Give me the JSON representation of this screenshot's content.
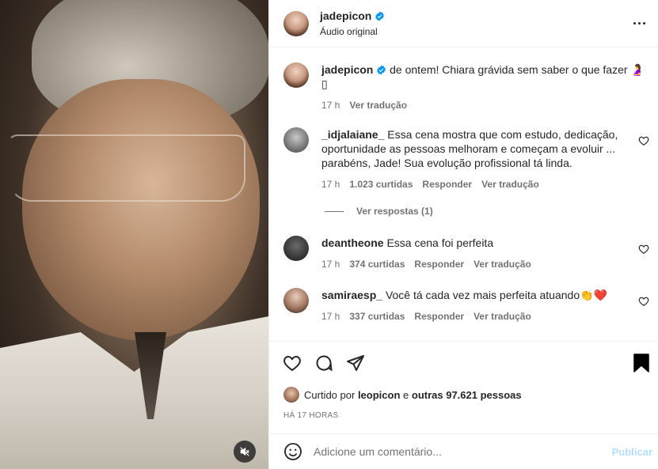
{
  "header": {
    "username": "jadepicon",
    "subtitle": "Áudio original"
  },
  "caption": {
    "username": "jadepicon",
    "text": "de ontem! Chiara grávida sem saber o que fazer 🤰",
    "text_line2": "▯",
    "time": "17 h",
    "see_translation": "Ver tradução"
  },
  "comments": [
    {
      "username": "_idjalaiane_",
      "text": "Essa cena mostra que com estudo, dedicação, oportunidade as pessoas melhoram e começam a evoluir ... parabéns, Jade! Sua evolução profissional tá linda.",
      "time": "17 h",
      "likes": "1.023 curtidas",
      "reply": "Responder",
      "translate": "Ver tradução"
    },
    {
      "username": "deantheone",
      "text": "Essa cena foi perfeita",
      "time": "17 h",
      "likes": "374 curtidas",
      "reply": "Responder",
      "translate": "Ver tradução"
    },
    {
      "username": "samiraesp_",
      "text": "Você tá cada vez mais perfeita atuando👏❤️",
      "time": "17 h",
      "likes": "337 curtidas",
      "reply": "Responder",
      "translate": "Ver tradução"
    }
  ],
  "view_replies": "Ver respostas (1)",
  "likes": {
    "prefix": "Curtido por",
    "user": "leopicon",
    "mid": "e",
    "others": "outras 97.621 pessoas"
  },
  "time_ago": "HÁ 17 HORAS",
  "add_comment": {
    "placeholder": "Adicione um comentário...",
    "post_label": "Publicar"
  },
  "colors": {
    "verified": "#0095f6",
    "post_disabled": "#b2dffc",
    "secondary_text": "#737373"
  },
  "icons": [
    "more-icon",
    "verified-icon",
    "heart-icon",
    "comment-icon",
    "share-icon",
    "bookmark-icon",
    "emoji-icon",
    "mute-icon"
  ]
}
